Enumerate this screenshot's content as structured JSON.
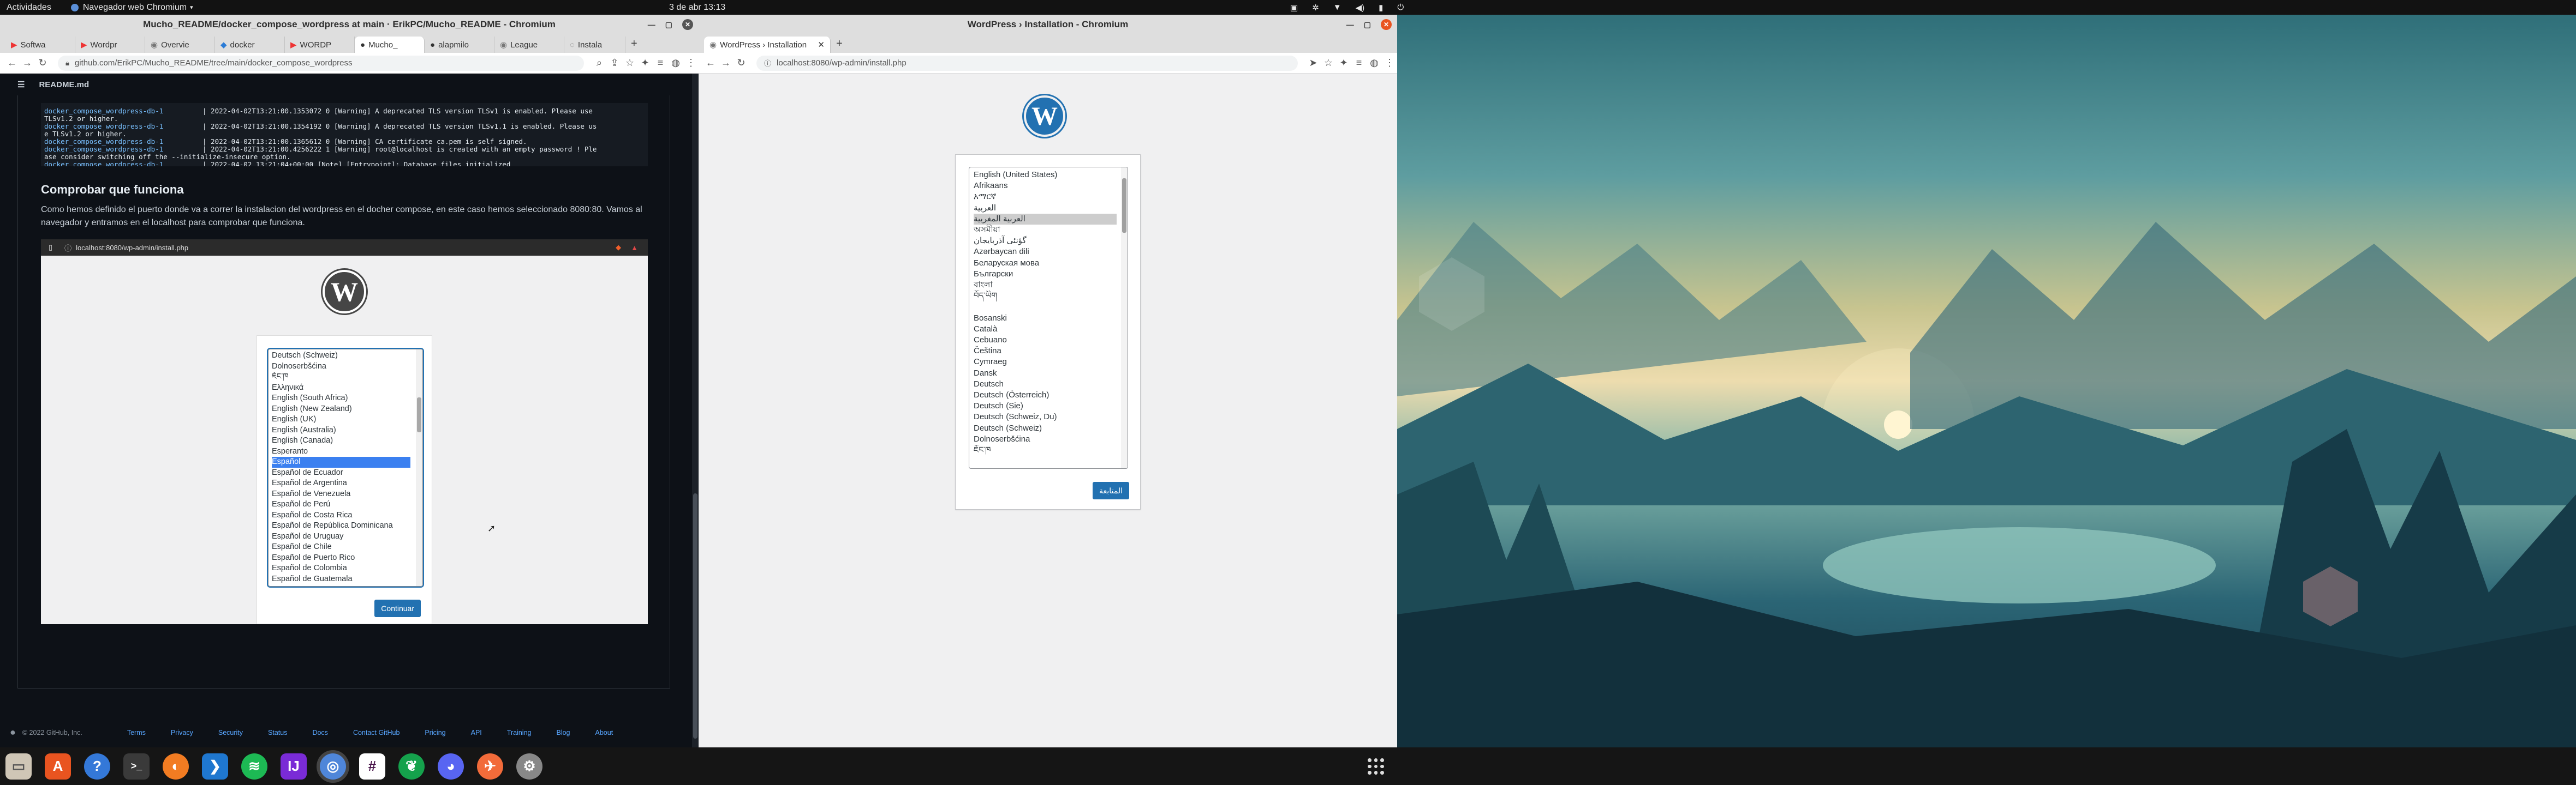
{
  "topbar": {
    "activities": "Actividades",
    "app_menu": "Navegador web Chromium",
    "clock": "3 de abr  13:13"
  },
  "left_window": {
    "title": "Mucho_README/docker_compose_wordpress at main · ErikPC/Mucho_README - Chromium",
    "tabs": [
      "Softwa",
      "Wordpr",
      "Overvie",
      "docker",
      "WORDP",
      "Mucho_",
      "alapmilo",
      "League",
      "Instala"
    ],
    "url": "github.com/ErikPC/Mucho_README/tree/main/docker_compose_wordpress",
    "readme_label": "README.md",
    "terminal_lines": [
      {
        "name": "docker_compose_wordpress-db-1",
        "text": "| 2022-04-02T13:21:00.1353072 0 [Warning] A deprecated TLS version TLSv1 is enabled. Please use"
      },
      {
        "name": "",
        "text": "TLSv1.2 or higher."
      },
      {
        "name": "docker_compose_wordpress-db-1",
        "text": "| 2022-04-02T13:21:00.1354192 0 [Warning] A deprecated TLS version TLSv1.1 is enabled. Please us"
      },
      {
        "name": "",
        "text": "e TLSv1.2 or higher."
      },
      {
        "name": "docker_compose_wordpress-db-1",
        "text": "| 2022-04-02T13:21:00.1365612 0 [Warning] CA certificate ca.pem is self signed."
      },
      {
        "name": "docker_compose_wordpress-db-1",
        "text": "| 2022-04-02T13:21:00.4256222 1 [Warning] root@localhost is created with an empty password ! Ple"
      },
      {
        "name": "",
        "text": "ase consider switching off the --initialize-insecure option."
      },
      {
        "name": "docker_compose_wordpress-db-1",
        "text": "| 2022-04-02 13:21:04+00:00 [Note] [Entrypoint]: Database files initialized"
      }
    ],
    "section_heading": "Comprobar que funciona",
    "paragraph": "Como hemos definido el puerto donde va a correr la instalacion del wordpress en el docher compose, en este caso hemos seleccionado 8080:80. Vamos al navegador y entramos en el localhost para comprobar que funciona.",
    "embedded_url": "localhost:8080/wp-admin/install.php",
    "embedded_languages": [
      "Deutsch (Schweiz)",
      "Dolnoserbšćina",
      "ཇོང་ཁ",
      "Ελληνικά",
      "English (South Africa)",
      "English (New Zealand)",
      "English (UK)",
      "English (Australia)",
      "English (Canada)",
      "Esperanto",
      "Español",
      "Español de Ecuador",
      "Español de Argentina",
      "Español de Venezuela",
      "Español de Perú",
      "Español de Costa Rica",
      "Español de República Dominicana",
      "Español de Uruguay",
      "Español de Chile",
      "Español de Puerto Rico",
      "Español de Colombia",
      "Español de Guatemala"
    ],
    "embedded_selected": "Español",
    "embedded_button": "Continuar",
    "footer": {
      "copyright": "© 2022 GitHub, Inc.",
      "links": [
        "Terms",
        "Privacy",
        "Security",
        "Status",
        "Docs",
        "Contact GitHub",
        "Pricing",
        "API",
        "Training",
        "Blog",
        "About"
      ]
    }
  },
  "right_window": {
    "title": "WordPress › Installation - Chromium",
    "tab": "WordPress › Installation",
    "url": "localhost:8080/wp-admin/install.php",
    "languages": [
      "English (United States)",
      "Afrikaans",
      "አማርኛ",
      "العربية",
      "العربية المغربية",
      "অসমীয়া",
      "گؤنئی آذربایجان",
      "Azərbaycan dili",
      "Беларуская мова",
      "Български",
      "বাংলা",
      "བོད་ཡིག",
      "",
      "Bosanski",
      "Català",
      "Cebuano",
      "Čeština",
      "Cymraeg",
      "Dansk",
      "Deutsch",
      "Deutsch (Österreich)",
      "Deutsch (Sie)",
      "Deutsch (Schweiz, Du)",
      "Deutsch (Schweiz)",
      "Dolnoserbšćina",
      "ཇོང་ཁ"
    ],
    "selected_language": "العربية المغربية",
    "button": "المتابعة"
  },
  "dock": {
    "apps": [
      "files-icon",
      "app-store-icon",
      "help-icon",
      "terminal-icon",
      "firefox-icon",
      "vscode-icon",
      "spotify-icon",
      "intellij-icon",
      "chromium-icon",
      "slack-icon",
      "mongodb-icon",
      "discord-icon",
      "postman-icon",
      "settings-icon"
    ]
  },
  "colors": {
    "accent": "#2271b1",
    "dock_running": "#e95420"
  }
}
